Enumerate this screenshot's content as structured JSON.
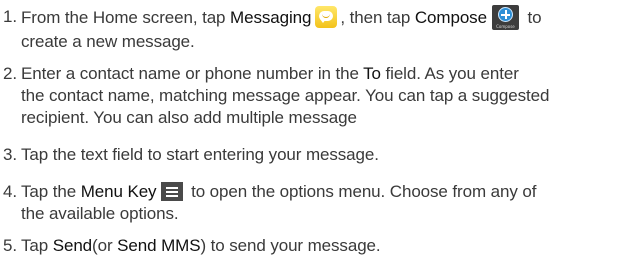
{
  "steps": [
    {
      "number": "1.",
      "line1_a": "From the Home screen, tap ",
      "line1_b": "Messaging",
      "line1_c": ", then tap ",
      "line1_d": "Compose",
      "line1_e": " to",
      "line2": "create a new message."
    },
    {
      "number": "2.",
      "line1_a": "Enter a contact name or phone number in the ",
      "line1_b": "To",
      "line1_c": " field. As you enter",
      "line2": "the contact name, matching message appear. You can tap a suggested",
      "line3": "recipient. You can also add multiple message"
    },
    {
      "number": "3.",
      "line1": "Tap the text field to start entering your message."
    },
    {
      "number": "4.",
      "line1_a": "Tap the ",
      "line1_b": "Menu Key",
      "line1_c": " to open the options menu. Choose from any of",
      "line2": "the available options."
    },
    {
      "number": "5.",
      "line1_a": "Tap ",
      "line1_b": "Send",
      "line1_c": "(or ",
      "line1_d": "Send MMS",
      "line1_e": ") to send your message."
    }
  ],
  "icons": {
    "messaging": "messaging-icon",
    "compose": "compose-icon",
    "compose_caption": "Compose",
    "menu": "menu-key-icon"
  },
  "colors": {
    "text": "#3a3a3a",
    "emphasis": "#111111",
    "messaging_icon": "#f3c21a",
    "compose_icon": "#2d8fd6"
  }
}
